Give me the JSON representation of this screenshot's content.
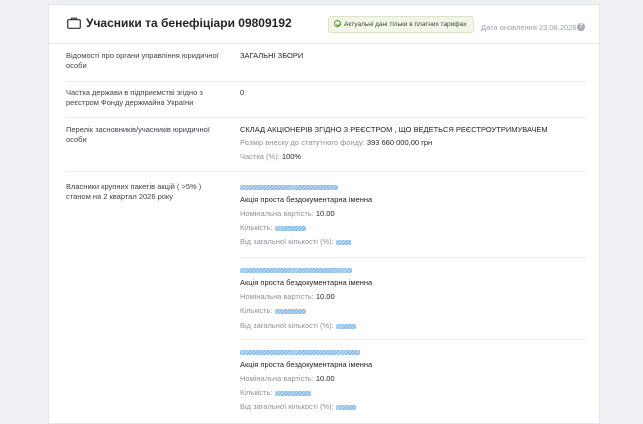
{
  "header": {
    "title": "Учасники та бенефіціари 09809192",
    "badge": "Актуальні дані тільки в платних тарифах",
    "updated": "Дата оновлення 23.08.2026",
    "help_glyph": "?"
  },
  "rows": [
    {
      "label": "Відомості про органи управління юридичної особи",
      "value": "ЗАГАЛЬНІ ЗБОРИ"
    },
    {
      "label": "Частка держави в підприємстві згідно з реєстром Фонду держмайна України",
      "value": "0"
    },
    {
      "label": "Перелік засновників/учасників юридичної особи",
      "value": "СКЛАД АКЦІОНЕРІВ ЗГІДНО З РЕЄСТРОМ , ЩО ВЕДЕТЬСЯ РЕЄСТРОУТРИМУВАЧЕМ",
      "contribution_label": "Розмір внеску до статутного фонду:",
      "contribution_value": "393 660 000,00 грн",
      "share_label": "Частка (%):",
      "share_value": "100%"
    }
  ],
  "shareholders": {
    "label": "Власники крупних пакетів акцій ( >5% ) станом на 2 квартал 2026 року",
    "items": [
      {
        "type": "Акція проста бездокументарна іменна",
        "nominal_label": "Номінальна вартість:",
        "nominal_value": "10.00",
        "qty_label": "Кількість:",
        "pct_label": "Від загальної кількості (%):"
      },
      {
        "type": "Акція проста бездокументарна іменна",
        "nominal_label": "Номінальна вартість:",
        "nominal_value": "10.00",
        "qty_label": "Кількість:",
        "pct_label": "Від загальної кількості (%):"
      },
      {
        "type": "Акція проста бездокументарна іменна",
        "nominal_label": "Номінальна вартість:",
        "nominal_value": "10.00",
        "qty_label": "Кількість:",
        "pct_label": "Від загальної кількості (%):"
      }
    ]
  },
  "colors": {
    "accent_badge_bg": "#f2f6e9",
    "blur": "#9cc8ee"
  }
}
